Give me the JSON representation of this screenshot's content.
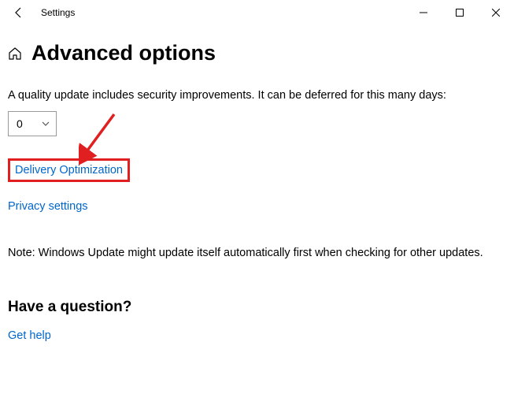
{
  "window": {
    "title": "Settings"
  },
  "page": {
    "heading": "Advanced options",
    "deferral_text": "A quality update includes security improvements. It can be deferred for this many days:",
    "deferral_value": "0",
    "link_delivery": "Delivery Optimization",
    "link_privacy": "Privacy settings",
    "note": "Note: Windows Update might update itself automatically first when checking for other updates.",
    "question_heading": "Have a question?",
    "link_help": "Get help"
  }
}
